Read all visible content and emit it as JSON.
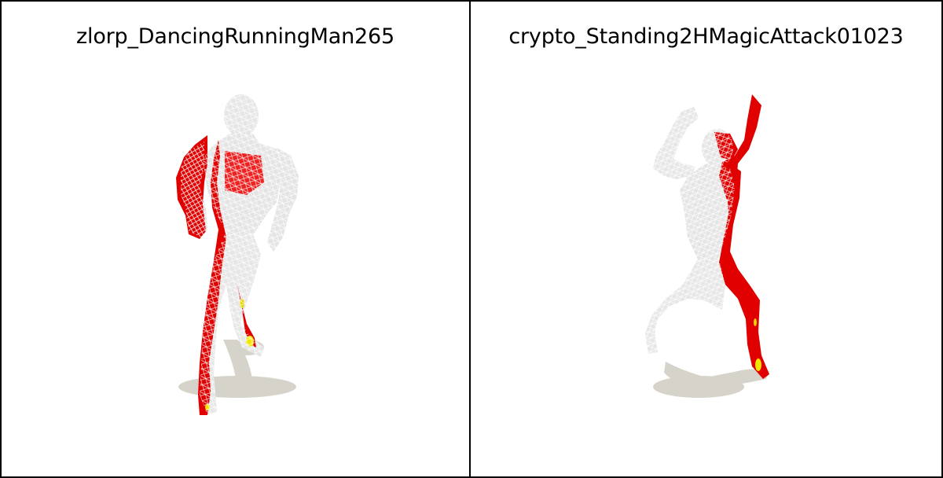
{
  "panels": [
    {
      "title": "zlorp_DancingRunningMan265"
    },
    {
      "title": "crypto_Standing2HMagicAttack01023"
    }
  ],
  "colors": {
    "border": "#000000",
    "background": "#ffffff",
    "mesh_base": "#e8e8e8",
    "wireframe": "#ffffff",
    "highlight_red": "#e00000",
    "highlight_yellow": "#f2e600",
    "shadow": "#d6d3cb"
  }
}
